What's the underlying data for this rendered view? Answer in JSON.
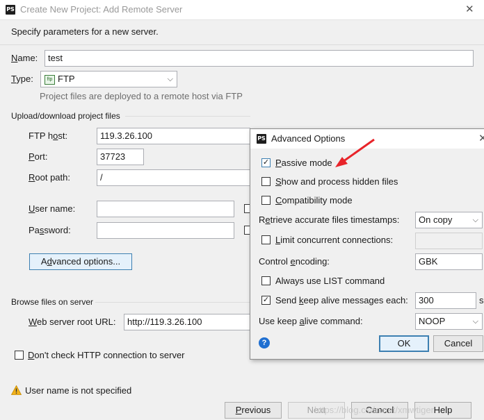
{
  "window": {
    "title": "Create New Project: Add Remote Server",
    "close_glyph": "✕"
  },
  "intro": "Specify parameters for a new server.",
  "name": {
    "label_u": "N",
    "label_rest": "ame:",
    "value": "test"
  },
  "type": {
    "label_u": "T",
    "label_rest": "ype:",
    "value": "FTP",
    "icon_text": "ftp",
    "arrow": "⌵"
  },
  "type_hint": "Project files are deployed to a remote host via FTP",
  "upload_section": {
    "title": "Upload/download project files"
  },
  "ftp_host": {
    "label_pre": "FTP h",
    "label_u": "o",
    "label_post": "st:",
    "value": "119.3.26.100"
  },
  "port": {
    "label_u": "P",
    "label_rest": "ort:",
    "value": "37723"
  },
  "root_path": {
    "label_u": "R",
    "label_rest": "oot path:",
    "value": "/"
  },
  "user_name": {
    "label_u": "U",
    "label_rest": "ser name:",
    "value": ""
  },
  "password": {
    "label_pre": "Pa",
    "label_u": "s",
    "label_post": "sword:",
    "value": ""
  },
  "advanced_button": {
    "pre": "A",
    "u": "d",
    "post": "vanced options..."
  },
  "browse_section": {
    "title": "Browse files on server"
  },
  "web_root": {
    "label_u": "W",
    "label_rest": "eb server root URL:",
    "value": "http://119.3.26.100"
  },
  "dont_check": {
    "label_u": "D",
    "label_rest": "on't check HTTP connection to server",
    "checked": false
  },
  "warning": {
    "text": "User name is not specified"
  },
  "footer": {
    "previous": {
      "u": "P",
      "rest": "revious"
    },
    "next": "Next",
    "cancel": "Cancel",
    "help": "Help"
  },
  "watermark": "https://blog.csdn.net/xmwtiger",
  "advanced": {
    "title": "Advanced Options",
    "passive_mode": {
      "u": "P",
      "rest": "assive mode",
      "checked": true
    },
    "show_hidden": {
      "u": "S",
      "rest": "how and process hidden files",
      "checked": false
    },
    "compatibility": {
      "u": "C",
      "rest": "ompatibility mode",
      "checked": false
    },
    "timestamps": {
      "pre": "R",
      "u": "e",
      "post": "trieve accurate files timestamps:",
      "value": "On copy"
    },
    "limit_conn": {
      "u": "L",
      "rest": "imit concurrent connections:",
      "checked": false,
      "value": ""
    },
    "encoding": {
      "pre": "Control ",
      "u": "e",
      "post": "ncoding:",
      "value": "GBK"
    },
    "list_cmd": {
      "text": "Always use LIST command",
      "checked": false
    },
    "keep_alive": {
      "pre": "Send ",
      "u": "k",
      "post": "eep alive messages each:",
      "checked": true,
      "value": "300",
      "unit": "s"
    },
    "keep_alive_cmd": {
      "pre": "Use keep ",
      "u": "a",
      "post": "live command:",
      "value": "NOOP"
    },
    "ok": "OK",
    "cancel": "Cancel",
    "help_glyph": "?"
  },
  "colors": {
    "accent": "#3c7fb1",
    "arrow": "#e8242a",
    "warning": "#f2b21b"
  }
}
